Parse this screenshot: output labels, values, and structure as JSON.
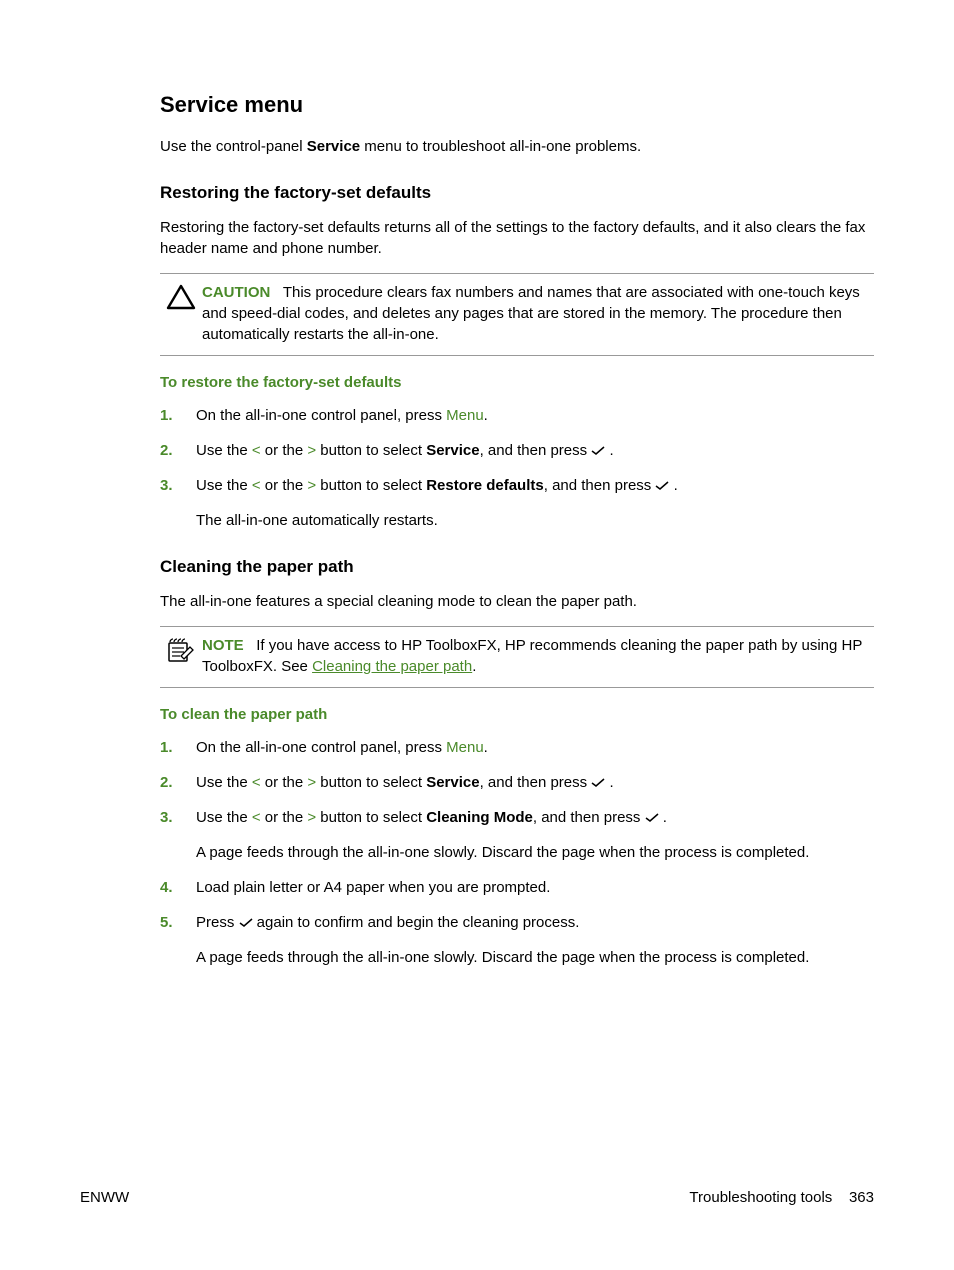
{
  "title": "Service menu",
  "intro_pre": "Use the control-panel ",
  "intro_bold": "Service",
  "intro_post": " menu to troubleshoot all-in-one problems.",
  "section1": {
    "heading": "Restoring the factory-set defaults",
    "para": "Restoring the factory-set defaults returns all of the settings to the factory defaults, and it also clears the fax header name and phone number.",
    "caution_label": "CAUTION",
    "caution_text": "This procedure clears fax numbers and names that are associated with one-touch keys and speed-dial codes, and deletes any pages that are stored in the memory. The procedure then automatically restarts the all-in-one.",
    "proc_heading": "To restore the factory-set defaults",
    "step1_pre": "On the all-in-one control panel, press ",
    "step1_menu": "Menu",
    "step1_post": ".",
    "step2_a": "Use the ",
    "step2_lt": "<",
    "step2_b": " or the ",
    "step2_gt": ">",
    "step2_c": " button to select ",
    "step2_d": "Service",
    "step2_e": ", and then press ",
    "step2_f": " .",
    "step3_a": "Use the ",
    "step3_lt": "<",
    "step3_b": " or the ",
    "step3_gt": ">",
    "step3_c": " button to select ",
    "step3_d": "Restore defaults",
    "step3_e": ", and then press ",
    "step3_f": " .",
    "step3_sub": "The all-in-one automatically restarts."
  },
  "section2": {
    "heading": "Cleaning the paper path",
    "para": "The all-in-one features a special cleaning mode to clean the paper path.",
    "note_label": "NOTE",
    "note_text_a": "If you have access to HP ToolboxFX, HP recommends cleaning the paper path by using HP ToolboxFX. See ",
    "note_link": "Cleaning the paper path",
    "note_text_b": ".",
    "proc_heading": "To clean the paper path",
    "step1_pre": "On the all-in-one control panel, press ",
    "step1_menu": "Menu",
    "step1_post": ".",
    "step2_a": "Use the ",
    "step2_lt": "<",
    "step2_b": " or the ",
    "step2_gt": ">",
    "step2_c": " button to select ",
    "step2_d": "Service",
    "step2_e": ", and then press ",
    "step2_f": " .",
    "step3_a": "Use the ",
    "step3_lt": "<",
    "step3_b": " or the ",
    "step3_gt": ">",
    "step3_c": " button to select ",
    "step3_d": "Cleaning Mode",
    "step3_e": ", and then press ",
    "step3_f": " .",
    "step3_sub": "A page feeds through the all-in-one slowly. Discard the page when the process is completed.",
    "step4": "Load plain letter or A4 paper when you are prompted.",
    "step5_a": "Press ",
    "step5_b": " again to confirm and begin the cleaning process.",
    "step5_sub": "A page feeds through the all-in-one slowly. Discard the page when the process is completed."
  },
  "footer": {
    "left": "ENWW",
    "right_label": "Troubleshooting tools",
    "right_page": "363"
  }
}
